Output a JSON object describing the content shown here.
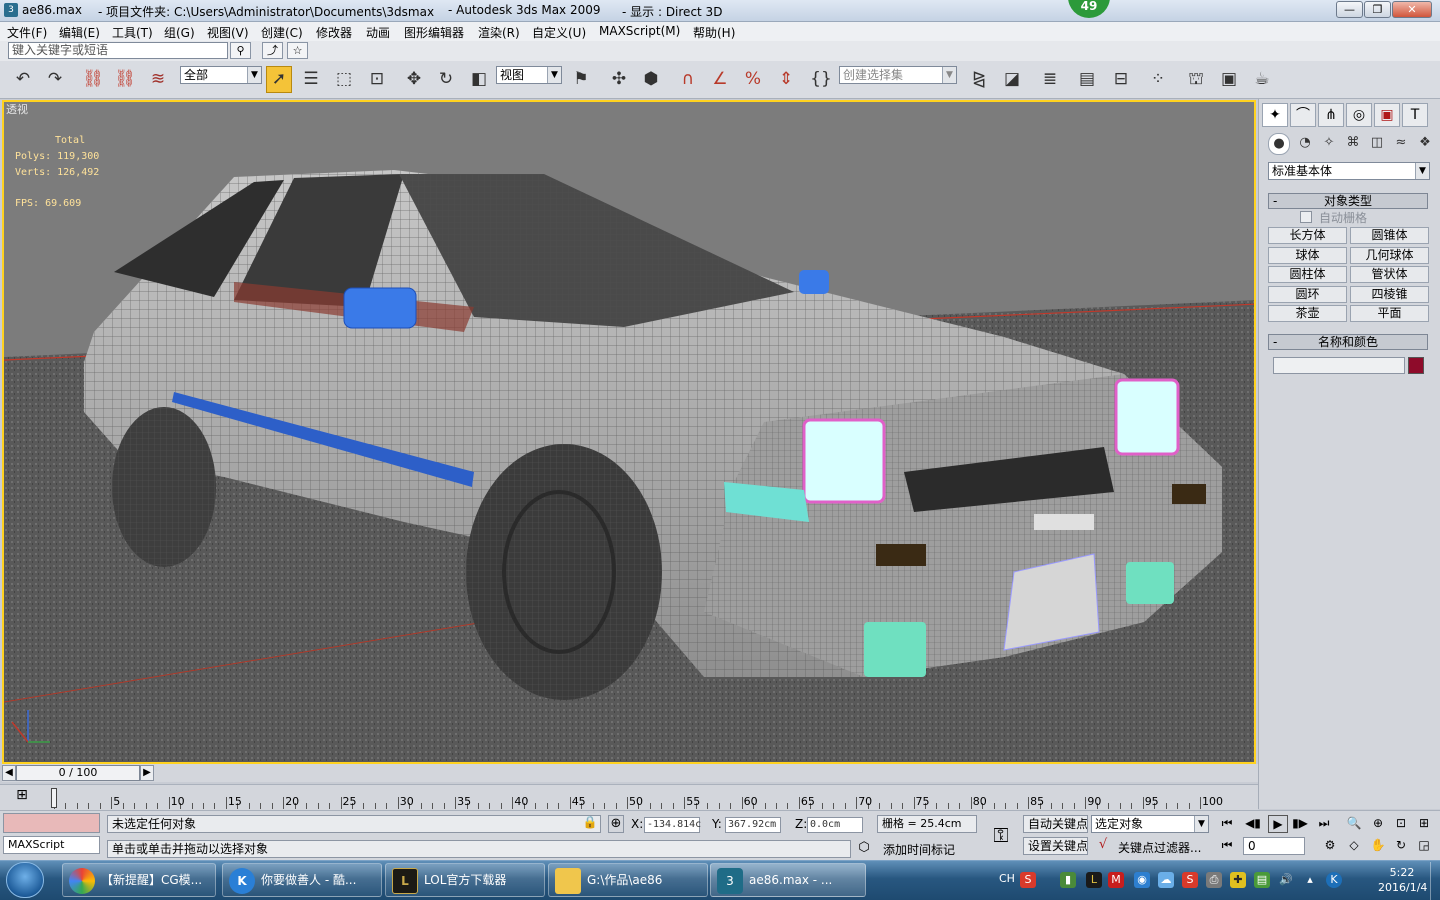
{
  "window": {
    "file": "ae86.max",
    "project_folder": "- 项目文件夹: C:\\Users\\Administrator\\Documents\\3dsmax",
    "app": "- Autodesk 3ds Max  2009",
    "display": "- 显示 : Direct 3D",
    "badge": "49"
  },
  "menu": [
    "文件(F)",
    "编辑(E)",
    "工具(T)",
    "组(G)",
    "视图(V)",
    "创建(C)",
    "修改器",
    "动画",
    "图形编辑器",
    "渲染(R)",
    "自定义(U)",
    "MAXScript(M)",
    "帮助(H)"
  ],
  "search": {
    "placeholder": "键入关键字或短语"
  },
  "toolbar": {
    "selection_filter": "全部",
    "ref_coord": "视图",
    "named_selection": "创建选择集"
  },
  "viewport": {
    "label": "透视",
    "stats": {
      "header": "Total",
      "polys": "Polys: 119,300",
      "verts": "Verts: 126,492",
      "fps": "FPS:   69.609"
    }
  },
  "command_panel": {
    "category": "标准基本体",
    "object_type_title": "对象类型",
    "autogrid": "自动栅格",
    "buttons": [
      "长方体",
      "圆锥体",
      "球体",
      "几何球体",
      "圆柱体",
      "管状体",
      "圆环",
      "四棱锥",
      "茶壶",
      "平面"
    ],
    "name_color_title": "名称和颜色",
    "object_color": "#8e0b2a"
  },
  "timeline": {
    "frame": "0 / 100",
    "ticks": [
      "0",
      "5",
      "10",
      "15",
      "20",
      "25",
      "30",
      "35",
      "40",
      "45",
      "50",
      "55",
      "60",
      "65",
      "70",
      "75",
      "80",
      "85",
      "90",
      "95",
      "100"
    ]
  },
  "status": {
    "maxscript": "MAXScript",
    "selection": "未选定任何对象",
    "prompt": "单击或单击并拖动以选择对象",
    "x": "-134.814c",
    "y": "367.92cm",
    "z": "0.0cm",
    "x_label": "X:",
    "y_label": "Y:",
    "z_label": "Z:",
    "grid": "栅格 = 25.4cm",
    "add_time_tag": "添加时间标记",
    "auto_key": "自动关键点",
    "set_key": "设置关键点",
    "selected_obj": "选定对象",
    "key_filters": "关键点过滤器...",
    "frame_field": "0"
  },
  "taskbar": {
    "items": [
      "【新提醒】CG模...",
      "你要做善人 - 酷...",
      "LOL官方下载器",
      "G:\\作品\\ae86",
      "ae86.max      - ..."
    ],
    "lang": "CH",
    "time": "5:22",
    "date": "2016/1/4"
  }
}
